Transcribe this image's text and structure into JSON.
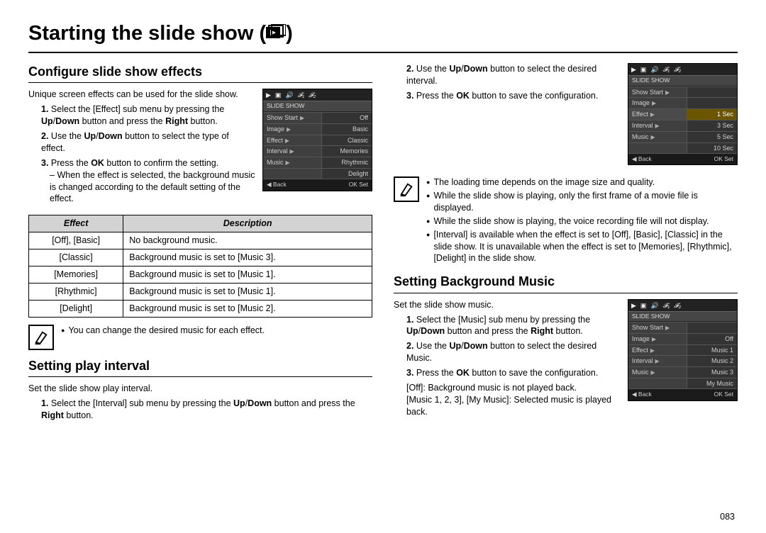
{
  "title": "Starting the slide show (",
  "title_close": ")",
  "page_number": "083",
  "left": {
    "section1": {
      "heading": "Configure slide show effects",
      "intro": "Unique screen effects can be used for the slide show.",
      "steps": [
        {
          "n": "1.",
          "body": "Select the [Effect] sub menu by pressing the ",
          "b1": "Up",
          "sep": "/",
          "b2": "Down",
          "tail": " button and press the ",
          "b3": "Right",
          "end": " button."
        },
        {
          "n": "2.",
          "body": "Use the ",
          "b1": "Up",
          "sep": "/",
          "b2": "Down",
          "tail": " button to select the type of effect."
        },
        {
          "n": "3.",
          "body": "Press the ",
          "b1": "OK",
          "tail": " button to confirm the setting."
        }
      ],
      "sub_dash": "When the effect is selected, the background music is changed according to the default setting of the effect.",
      "screen": {
        "header": "SLIDE SHOW",
        "rows": [
          {
            "l": "Show Start",
            "r": "Off"
          },
          {
            "l": "Image",
            "r": "Basic"
          },
          {
            "l": "Effect",
            "r": "Classic"
          },
          {
            "l": "Interval",
            "r": "Memories"
          },
          {
            "l": "Music",
            "r": "Rhythmic"
          },
          {
            "l": "",
            "r": "Delight"
          }
        ],
        "foot_l": "◀  Back",
        "foot_r": "OK Set"
      },
      "table_headers": {
        "c1": "Effect",
        "c2": "Description"
      },
      "table_rows": [
        {
          "effect": "[Off], [Basic]",
          "desc": "No background music."
        },
        {
          "effect": "[Classic]",
          "desc": "Background music is set to [Music 3]."
        },
        {
          "effect": "[Memories]",
          "desc": "Background music is set to [Music 1]."
        },
        {
          "effect": "[Rhythmic]",
          "desc": "Background music is set to [Music 1]."
        },
        {
          "effect": "[Delight]",
          "desc": "Background music is set to [Music 2]."
        }
      ],
      "note": "You can change the desired music for each effect."
    },
    "section2": {
      "heading": "Setting play interval",
      "intro": "Set the slide show play interval.",
      "steps": [
        {
          "n": "1.",
          "body": "Select the [Interval] sub menu by pressing the ",
          "b1": "Up",
          "sep": "/",
          "b2": "Down",
          "tail": " button and press the ",
          "b3": "Right",
          "end": " button."
        }
      ]
    }
  },
  "right": {
    "section_cont": {
      "steps": [
        {
          "n": "2.",
          "body": "Use the ",
          "b1": "Up",
          "sep": "/",
          "b2": "Down",
          "tail": " button to select the desired interval."
        },
        {
          "n": "3.",
          "body": "Press the ",
          "b1": "OK",
          "tail": " button to save the configuration."
        }
      ],
      "screen": {
        "header": "SLIDE SHOW",
        "rows": [
          {
            "l": "Show Start",
            "r": ""
          },
          {
            "l": "Image",
            "r": ""
          },
          {
            "l": "Effect",
            "r": "1 Sec"
          },
          {
            "l": "Interval",
            "r": "3 Sec"
          },
          {
            "l": "Music",
            "r": "5 Sec"
          },
          {
            "l": "",
            "r": "10 Sec"
          }
        ],
        "foot_l": "◀  Back",
        "foot_r": "OK Set"
      },
      "notes": [
        "The loading time depends on the image size and quality.",
        "While the slide show is playing, only the first frame of a movie file is displayed.",
        "While the slide show is playing, the voice recording file will not display.",
        "[Interval] is available when the effect is set to [Off], [Basic], [Classic] in the slide show. It is unavailable when the effect is set to [Memories], [Rhythmic], [Delight] in the slide show."
      ]
    },
    "section3": {
      "heading": "Setting Background Music",
      "intro": "Set the slide show music.",
      "steps": [
        {
          "n": "1.",
          "body": "Select the [Music] sub menu by pressing the ",
          "b1": "Up",
          "sep": "/",
          "b2": "Down",
          "tail": " button and press the ",
          "b3": "Right",
          "end": " button."
        },
        {
          "n": "2.",
          "body": "Use the ",
          "b1": "Up",
          "sep": "/",
          "b2": "Down",
          "tail": " button to select the desired Music."
        },
        {
          "n": "3.",
          "body": "Press the ",
          "b1": "OK",
          "tail": " button to save the configuration."
        }
      ],
      "after": [
        "[Off]: Background music is not played back.",
        "[Music 1, 2, 3], [My Music]: Selected music is played back."
      ],
      "screen": {
        "header": "SLIDE SHOW",
        "rows": [
          {
            "l": "Show Start",
            "r": ""
          },
          {
            "l": "Image",
            "r": "Off"
          },
          {
            "l": "Effect",
            "r": "Music 1"
          },
          {
            "l": "Interval",
            "r": "Music 2"
          },
          {
            "l": "Music",
            "r": "Music 3"
          },
          {
            "l": "",
            "r": "My Music"
          }
        ],
        "foot_l": "◀  Back",
        "foot_r": "OK Set"
      }
    }
  }
}
